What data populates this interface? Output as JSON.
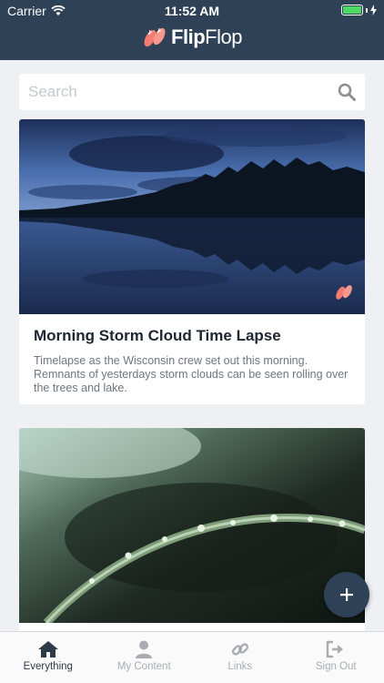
{
  "status_bar": {
    "carrier": "Carrier",
    "time": "11:52 AM",
    "battery_percent": 100
  },
  "brand": {
    "name_bold": "Flip",
    "name_regular": "Flop",
    "icon": "flip-flops-icon"
  },
  "search": {
    "placeholder": "Search",
    "value": "",
    "icon": "search-icon"
  },
  "cards": [
    {
      "title": "Morning Storm Cloud Time Lapse",
      "description": "Timelapse as the Wisconsin crew set out this morning. Remnants of yesterdays storm clouds can be seen rolling over the trees and lake."
    },
    {
      "title": "",
      "description": ""
    }
  ],
  "fab": {
    "label": "+",
    "icon": "plus-icon"
  },
  "tabs": [
    {
      "label": "Everything",
      "icon": "home-icon",
      "active": true
    },
    {
      "label": "My Content",
      "icon": "person-icon",
      "active": false
    },
    {
      "label": "Links",
      "icon": "link-icon",
      "active": false
    },
    {
      "label": "Sign Out",
      "icon": "sign-out-icon",
      "active": false
    }
  ],
  "colors": {
    "header": "#2e4156",
    "accent_logo": "#f47c72",
    "tab_active": "#2e3a47",
    "tab_inactive": "#a9adb2"
  }
}
